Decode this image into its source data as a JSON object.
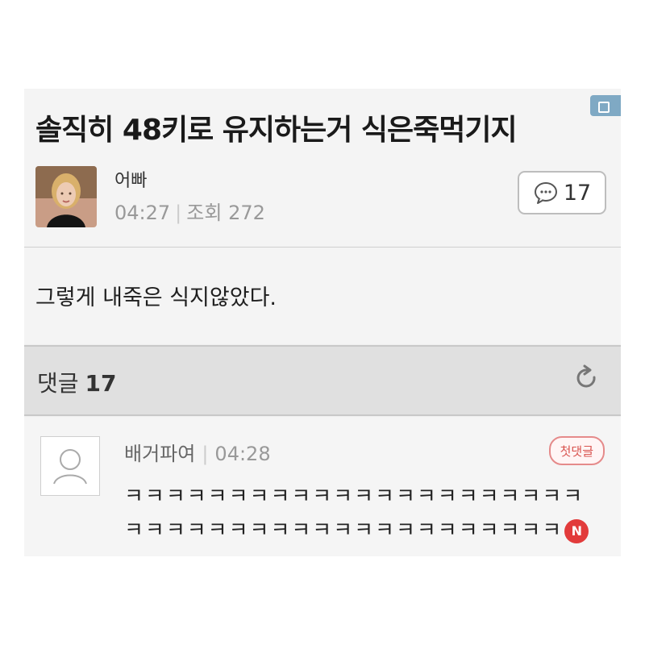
{
  "post": {
    "title": "솔직히 48키로 유지하는거 식은죽먹기지",
    "author": "어빠",
    "time": "04:27",
    "views_label": "조회",
    "views": "272",
    "comment_count": "17",
    "body": "그렇게 내죽은 식지않았다."
  },
  "comments_section": {
    "title": "댓글",
    "count": "17"
  },
  "comment": {
    "author": "배거파여",
    "time": "04:28",
    "badge": "첫댓글",
    "text": "ㅋㅋㅋㅋㅋㅋㅋㅋㅋㅋㅋㅋㅋㅋㅋㅋㅋㅋㅋㅋㅋㅋㅋㅋㅋㅋㅋㅋㅋㅋㅋㅋㅋㅋㅋㅋㅋㅋㅋㅋㅋㅋㅋ",
    "new_label": "N"
  },
  "icons": {
    "comment_bubble": "speech-bubble-icon",
    "refresh": "refresh-icon",
    "default_avatar": "user-silhouette-icon"
  },
  "colors": {
    "new_badge": "#e23b3b",
    "first_comment_badge": "#d9534f"
  }
}
